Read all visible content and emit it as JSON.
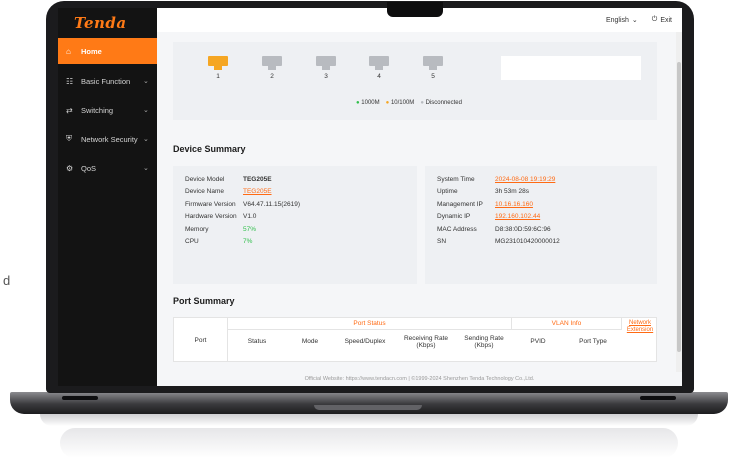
{
  "page": {
    "side_letter": "d"
  },
  "brand": {
    "logo": "Tenda"
  },
  "sidebar": {
    "items": [
      {
        "label": "Home",
        "icon": "home-icon",
        "glyph": "⌂"
      },
      {
        "label": "Basic Function",
        "icon": "basic-function-icon",
        "glyph": "☷"
      },
      {
        "label": "Switching",
        "icon": "switching-icon",
        "glyph": "⇄"
      },
      {
        "label": "Network Security",
        "icon": "shield-icon",
        "glyph": "⛨"
      },
      {
        "label": "QoS",
        "icon": "qos-icon",
        "glyph": "⚙"
      }
    ]
  },
  "topbar": {
    "language": "English",
    "exit": "Exit"
  },
  "ports": {
    "items": [
      {
        "num": "1",
        "state": "on"
      },
      {
        "num": "2",
        "state": "off"
      },
      {
        "num": "3",
        "state": "off"
      },
      {
        "num": "4",
        "state": "off"
      },
      {
        "num": "5",
        "state": "off"
      }
    ],
    "legend": {
      "g": "1000M",
      "y": "10/100M",
      "k": "Disconnected"
    },
    "colors": {
      "gigabit": "#2fbf4a",
      "fast": "#f5a623",
      "disconnected": "#b8bbc0"
    }
  },
  "device_summary": {
    "title": "Device Summary",
    "left": [
      {
        "k": "Device Model",
        "v": "TEG205E",
        "style": "bold"
      },
      {
        "k": "Device Name",
        "v": "TEG205E",
        "style": "link"
      },
      {
        "k": "Firmware Version",
        "v": "V64.47.11.15(2619)",
        "style": ""
      },
      {
        "k": "Hardware Version",
        "v": "V1.0",
        "style": ""
      },
      {
        "k": "Memory",
        "v": "57%",
        "style": "green"
      },
      {
        "k": "CPU",
        "v": "7%",
        "style": "green"
      }
    ],
    "right": [
      {
        "k": "System Time",
        "v": "2024-08-08 19:19:29",
        "style": "link"
      },
      {
        "k": "Uptime",
        "v": "3h 53m 28s",
        "style": ""
      },
      {
        "k": "Management IP",
        "v": "10.16.16.160",
        "style": "link"
      },
      {
        "k": "Dynamic IP",
        "v": "192.160.102.44",
        "style": "link"
      },
      {
        "k": "MAC Address",
        "v": "D8:38:0D:59:6C:96",
        "style": ""
      },
      {
        "k": "SN",
        "v": "MG231010420000012",
        "style": ""
      }
    ]
  },
  "port_summary": {
    "title": "Port Summary",
    "port_col": "Port",
    "status_group": "Port Status",
    "vlan_group": "VLAN Info",
    "ext": "Network Extension",
    "sub": [
      "Status",
      "Mode",
      "Speed/Duplex",
      "Receiving Rate (Kbps)",
      "Sending Rate (Kbps)",
      "PVID",
      "Port Type"
    ]
  },
  "footer": {
    "text": "Official Website: https://www.tendacn.com | ©1999-2024 Shenzhen Tenda Technology Co.,Ltd."
  }
}
